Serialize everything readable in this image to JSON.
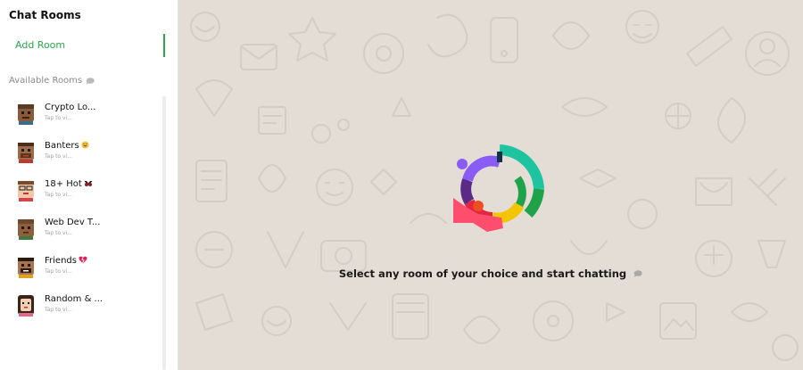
{
  "sidebar": {
    "title": "Chat Rooms",
    "add_room_label": "Add Room",
    "available_label": "Available Rooms",
    "available_icon": "speech-bubble-icon",
    "rooms": [
      {
        "name": "Crypto Lo...",
        "sub": "Tap to vi...",
        "emoji": ""
      },
      {
        "name": "Banters",
        "sub": "Tap to vi...",
        "emoji": "laughing-face"
      },
      {
        "name": "18+ Hot",
        "sub": "Tap to vi...",
        "emoji": "bikini-top"
      },
      {
        "name": "Web Dev T...",
        "sub": "Tap to vi...",
        "emoji": ""
      },
      {
        "name": "Friends",
        "sub": "Tap to vi...",
        "emoji": "broken-heart"
      },
      {
        "name": "Random & ...",
        "sub": "Tap to vi...",
        "emoji": ""
      }
    ]
  },
  "main": {
    "message": "Select any room of your choice and start chatting",
    "message_icon": "speech-bubble-icon"
  },
  "colors": {
    "accent": "#2aa84a",
    "background": "#e4ddd6"
  }
}
